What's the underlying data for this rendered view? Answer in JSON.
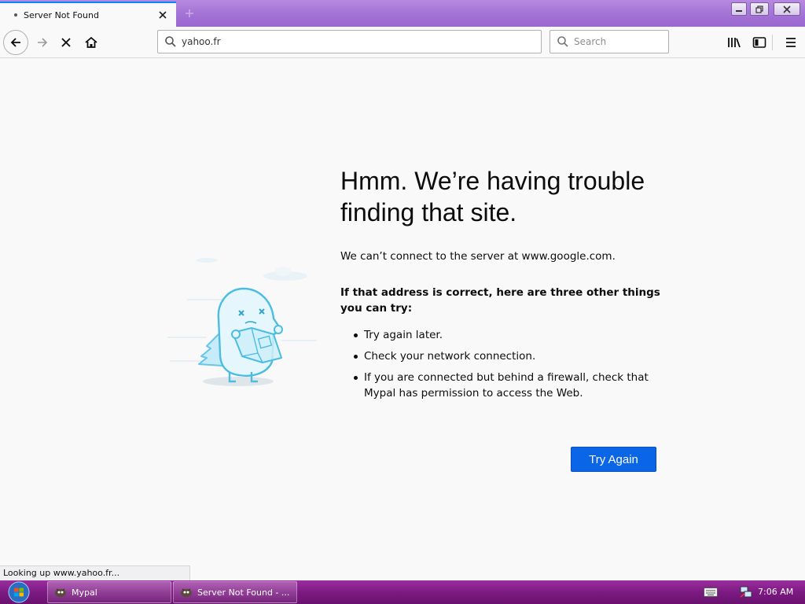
{
  "tab": {
    "title": "Server Not Found",
    "close_icon": "close-icon",
    "new_tab_icon": "plus-icon"
  },
  "toolbar": {
    "url": "yahoo.fr",
    "search_placeholder": "Search",
    "back_icon": "arrow-left-icon",
    "forward_icon": "arrow-right-icon",
    "stop_icon": "stop-x-icon",
    "home_icon": "home-icon",
    "library_icon": "library-icon",
    "sidebar_icon": "sidebar-icon",
    "menu_icon": "hamburger-menu-icon"
  },
  "error": {
    "title": "Hmm. We’re having trouble finding that site.",
    "description": "We can’t connect to the server at www.google.com.",
    "advice_heading": "If that address is correct, here are three other things you can try:",
    "advice_items": [
      "Try again later.",
      "Check your network connection.",
      "If you are connected but behind a firewall, check that Mypal has permission to access the Web."
    ],
    "try_again_label": "Try Again"
  },
  "status": {
    "text": "Looking up www.yahoo.fr..."
  },
  "taskbar": {
    "items": [
      {
        "label": "Mypal"
      },
      {
        "label": "Server Not Found - ..."
      }
    ],
    "clock": "7:06 AM"
  },
  "colors": {
    "accent": "#0a66e6",
    "tab_accent": "#0a84ff",
    "titlebar": "#a474d6",
    "taskbar": "#7c1a82",
    "page_bg": "#f9f9fa"
  }
}
